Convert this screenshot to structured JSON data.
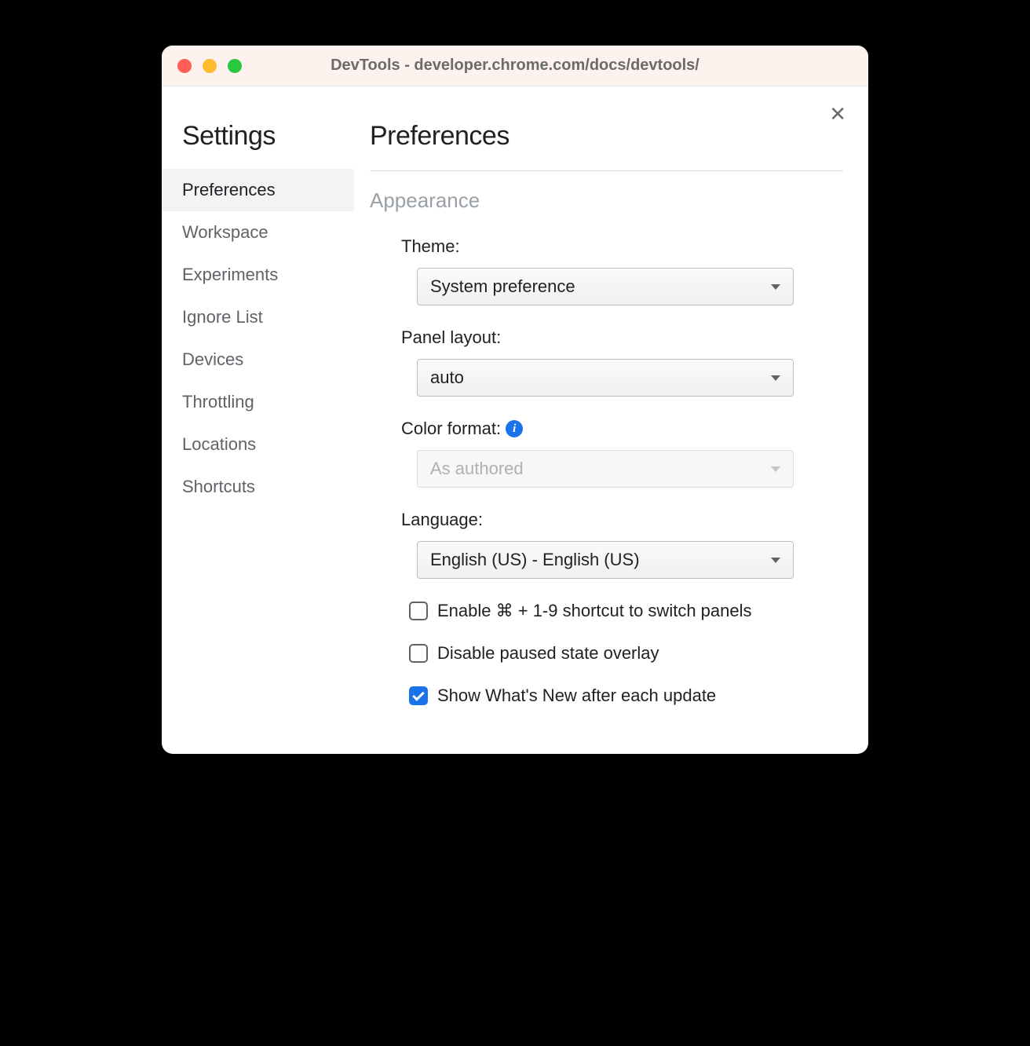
{
  "window": {
    "title": "DevTools - developer.chrome.com/docs/devtools/"
  },
  "sidebar": {
    "title": "Settings",
    "items": [
      {
        "label": "Preferences",
        "active": true
      },
      {
        "label": "Workspace",
        "active": false
      },
      {
        "label": "Experiments",
        "active": false
      },
      {
        "label": "Ignore List",
        "active": false
      },
      {
        "label": "Devices",
        "active": false
      },
      {
        "label": "Throttling",
        "active": false
      },
      {
        "label": "Locations",
        "active": false
      },
      {
        "label": "Shortcuts",
        "active": false
      }
    ]
  },
  "main": {
    "title": "Preferences",
    "section": {
      "title": "Appearance",
      "fields": {
        "theme": {
          "label": "Theme:",
          "value": "System preference"
        },
        "panel_layout": {
          "label": "Panel layout:",
          "value": "auto"
        },
        "color_format": {
          "label": "Color format:",
          "value": "As authored",
          "disabled": true,
          "has_info": true
        },
        "language": {
          "label": "Language:",
          "value": "English (US) - English (US)"
        }
      },
      "checkboxes": [
        {
          "label": "Enable ⌘ + 1-9 shortcut to switch panels",
          "checked": false
        },
        {
          "label": "Disable paused state overlay",
          "checked": false
        },
        {
          "label": "Show What's New after each update",
          "checked": true
        }
      ]
    }
  }
}
